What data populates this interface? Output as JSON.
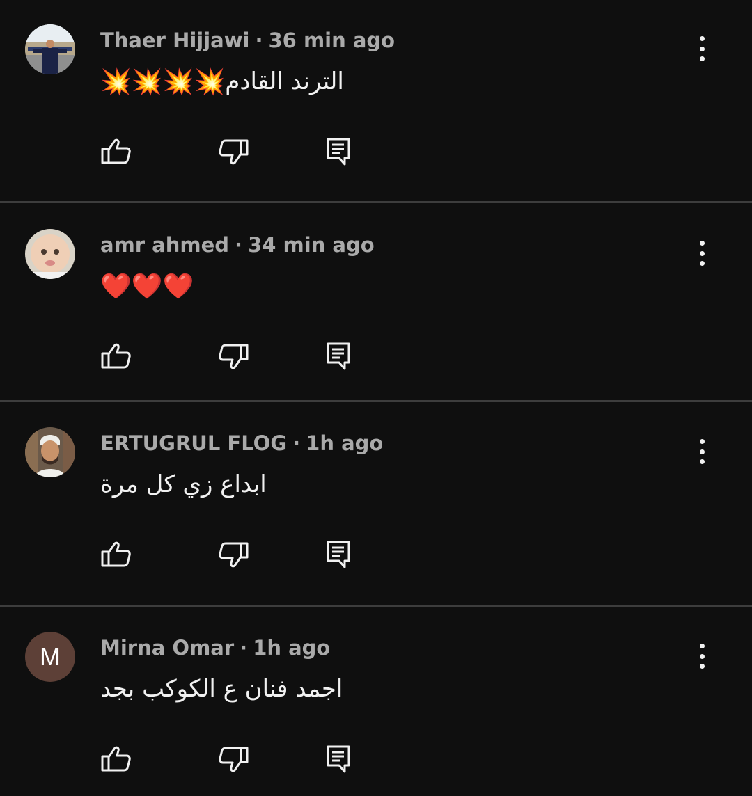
{
  "comments": [
    {
      "author": "Thaer Hijjawi",
      "time": "36 min ago",
      "text": "الترند القادم",
      "emoji": "💥💥💥💥",
      "avatar_type": "photo-outdoor"
    },
    {
      "author": "amr ahmed",
      "time": "34 min ago",
      "text": "",
      "emoji": "❤️❤️❤️",
      "avatar_type": "photo-baby"
    },
    {
      "author": "ERTUGRUL FLOG",
      "time": "1h ago",
      "text": "ابداع زي كل مرة",
      "emoji": "",
      "avatar_type": "photo-man"
    },
    {
      "author": "Mirna Omar",
      "time": "1h ago",
      "text": "اجمد فنان ع الكوكب بجد",
      "emoji": "",
      "avatar_letter": "M",
      "avatar_color": "#5d4037"
    }
  ],
  "separator": "·",
  "icons": {
    "like": "thumbs-up-icon",
    "dislike": "thumbs-down-icon",
    "reply": "comment-reply-icon",
    "more": "more-vertical-icon"
  },
  "colors": {
    "background": "#0f0f0f",
    "meta_text": "#aaaaaa",
    "body_text": "#f1f1f1",
    "divider": "#3d3d3d"
  }
}
